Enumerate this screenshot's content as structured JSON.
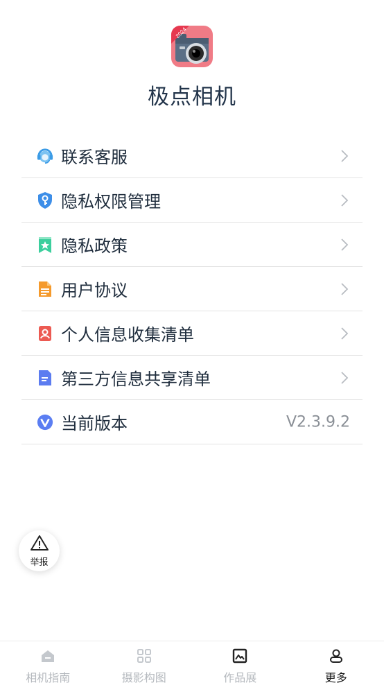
{
  "app": {
    "name": "极点相机",
    "logo_badge": "2024"
  },
  "menu": {
    "items": [
      {
        "label": "联系客服",
        "icon": "headset-icon"
      },
      {
        "label": "隐私权限管理",
        "icon": "shield-key-icon"
      },
      {
        "label": "隐私政策",
        "icon": "bookmark-star-icon"
      },
      {
        "label": "用户协议",
        "icon": "document-icon"
      },
      {
        "label": "个人信息收集清单",
        "icon": "person-card-icon"
      },
      {
        "label": "第三方信息共享清单",
        "icon": "file-list-icon"
      },
      {
        "label": "当前版本",
        "icon": "version-v-icon",
        "value": "V2.3.9.2"
      }
    ]
  },
  "report": {
    "label": "举报",
    "icon": "warning-triangle-icon"
  },
  "tabbar": {
    "tabs": [
      {
        "label": "相机指南",
        "icon": "home-icon",
        "active": false
      },
      {
        "label": "摄影构图",
        "icon": "grid-icon",
        "active": false
      },
      {
        "label": "作品展",
        "icon": "image-icon",
        "active": false
      },
      {
        "label": "更多",
        "icon": "user-icon",
        "active": true
      }
    ]
  },
  "colors": {
    "title": "#22344a",
    "divider": "#e3e3e3",
    "tab_inactive": "#b5b9be",
    "tab_active": "#1b1b1b",
    "logo_bg": "#f07b86"
  }
}
